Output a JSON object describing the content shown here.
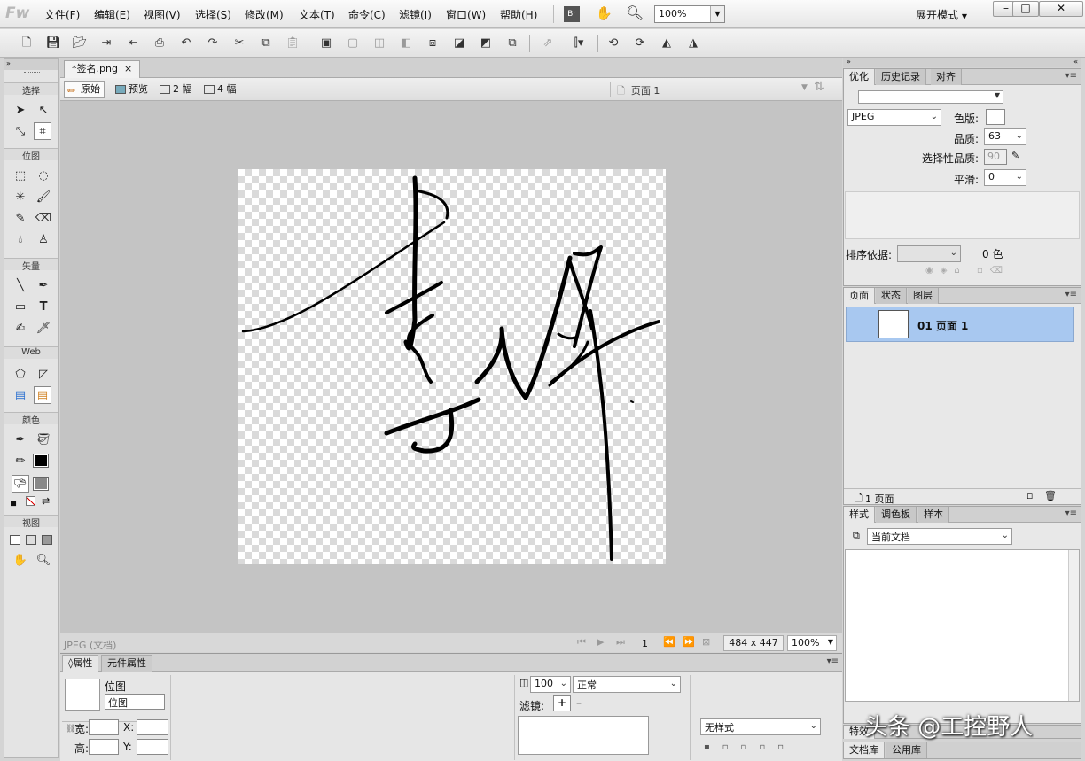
{
  "app": {
    "logo": "Fw",
    "expand_mode": "展开模式"
  },
  "menu": [
    "文件(F)",
    "编辑(E)",
    "视图(V)",
    "选择(S)",
    "修改(M)",
    "文本(T)",
    "命令(C)",
    "滤镜(I)",
    "窗口(W)",
    "帮助(H)"
  ],
  "top": {
    "bridge": "Br",
    "zoom": "100%"
  },
  "tools": {
    "sections": [
      "选择",
      "位图",
      "矢量",
      "Web",
      "颜色",
      "视图"
    ]
  },
  "document": {
    "tab": "*签名.png",
    "tab_close": "×"
  },
  "view_modes": {
    "original": "原始",
    "preview": "预览",
    "two_up": "2 幅",
    "four_up": "4 幅",
    "page": "页面 1"
  },
  "status": {
    "format": "JPEG (文档)",
    "page_num": "1",
    "size": "484 x 447",
    "zoom": "100%"
  },
  "properties": {
    "tabs": [
      "属性",
      "元件属性"
    ],
    "object_type": "位图",
    "object_name": "位图",
    "width_label": "宽:",
    "height_label": "高:",
    "x_label": "X:",
    "y_label": "Y:",
    "opacity": "100",
    "blend": "正常",
    "filters_label": "滤镜:",
    "style": "无样式"
  },
  "optimize": {
    "tabs": [
      "优化",
      "历史记录",
      "对齐"
    ],
    "format": "JPEG",
    "matte_label": "色版:",
    "quality_label": "品质:",
    "quality": "63",
    "selective_label": "选择性品质:",
    "selective_value": "90",
    "smoothing_label": "平滑:",
    "smoothing": "0",
    "sort_label": "排序依据:",
    "colors": "0 色"
  },
  "pages": {
    "tabs": [
      "页面",
      "状态",
      "图层"
    ],
    "item": "01 页面 1",
    "footer": "1 页面"
  },
  "styles": {
    "tabs": [
      "样式",
      "调色板",
      "样本"
    ],
    "source": "当前文档"
  },
  "bottom_panels": {
    "tabs_1": [
      "特效"
    ],
    "tabs_2": [
      "文档库",
      "公用库"
    ]
  },
  "watermark": "头条 @工控野人",
  "colors": {
    "accent": "#a8c8f0",
    "canvas_bg": "#c4c4c4"
  }
}
